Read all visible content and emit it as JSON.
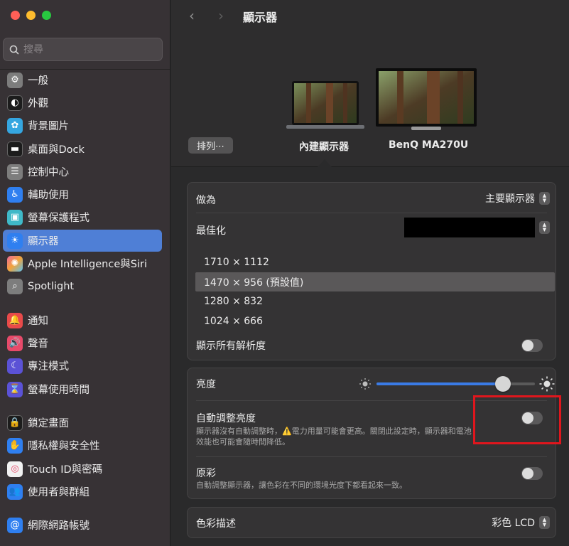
{
  "sidebar": {
    "search_placeholder": "搜尋",
    "items": [
      {
        "label": "一般",
        "icon": "gear-icon"
      },
      {
        "label": "外觀",
        "icon": "appearance-icon"
      },
      {
        "label": "背景圖片",
        "icon": "wallpaper-icon"
      },
      {
        "label": "桌面與Dock",
        "icon": "dock-icon"
      },
      {
        "label": "控制中心",
        "icon": "control-center-icon"
      },
      {
        "label": "輔助使用",
        "icon": "accessibility-icon"
      },
      {
        "label": "螢幕保護程式",
        "icon": "screensaver-icon"
      },
      {
        "label": "顯示器",
        "icon": "display-icon"
      },
      {
        "label": "Apple Intelligence與Siri",
        "icon": "siri-icon"
      },
      {
        "label": "Spotlight",
        "icon": "spotlight-icon"
      },
      {
        "label": "通知",
        "icon": "notifications-icon"
      },
      {
        "label": "聲音",
        "icon": "sound-icon"
      },
      {
        "label": "專注模式",
        "icon": "focus-icon"
      },
      {
        "label": "螢幕使用時間",
        "icon": "screen-time-icon"
      },
      {
        "label": "鎖定畫面",
        "icon": "lock-icon"
      },
      {
        "label": "隱私權與安全性",
        "icon": "privacy-hand-icon"
      },
      {
        "label": "Touch ID與密碼",
        "icon": "fingerprint-icon"
      },
      {
        "label": "使用者與群組",
        "icon": "users-icon"
      },
      {
        "label": "網際網路帳號",
        "icon": "at-icon"
      }
    ],
    "active_index": 7
  },
  "header": {
    "title": "顯示器",
    "arrange_label": "排列⋯",
    "displays": [
      {
        "name": "內建顯示器",
        "selected": true
      },
      {
        "name": "BenQ MA270U",
        "selected": false
      }
    ]
  },
  "settings": {
    "use_as": {
      "label": "做為",
      "value": "主要顯示器"
    },
    "optimize": {
      "label": "最佳化"
    },
    "resolutions": [
      {
        "label": "1710 × 1112",
        "selected": false
      },
      {
        "label": "1470 × 956 (預設值)",
        "selected": true
      },
      {
        "label": "1280 × 832",
        "selected": false
      },
      {
        "label": "1024 × 666",
        "selected": false
      }
    ],
    "show_all": {
      "label": "顯示所有解析度",
      "on": false
    },
    "brightness": {
      "label": "亮度",
      "level": 0.8
    },
    "auto_brightness": {
      "label": "自動調整亮度",
      "desc_line1": "顯示器沒有自動調整時，⚠️電力用量可能會更高。關閉此設定時，顯示器和電池",
      "desc_line2": "效能也可能會隨時間降低。",
      "on": false
    },
    "true_tone": {
      "label": "原彩",
      "desc": "自動調整顯示器，讓色彩在不同的環境光度下都看起來一致。",
      "on": false
    },
    "color_profile": {
      "label": "色彩描述",
      "value": "彩色 LCD"
    }
  },
  "colors": {
    "accent": "#4f7fd6",
    "sidebar_bg": "#373235",
    "highlight_box": "#e0161d"
  }
}
